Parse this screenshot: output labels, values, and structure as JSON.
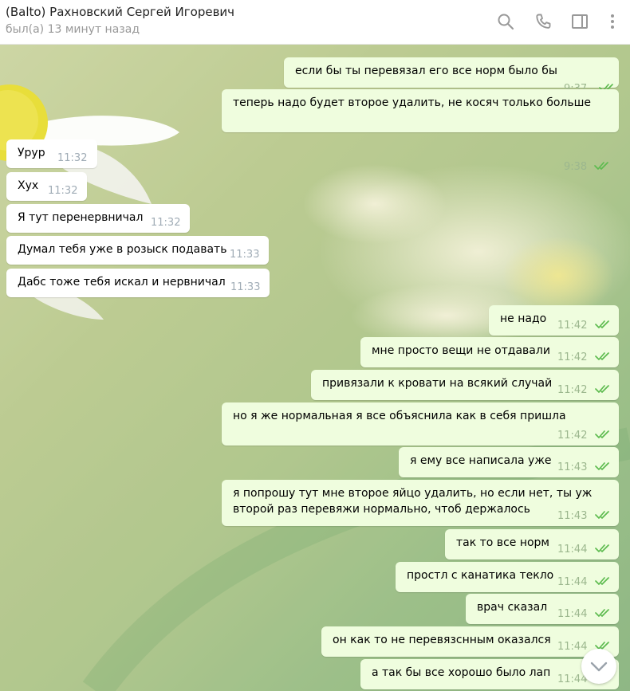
{
  "header": {
    "title": "(Balto) Рахновский Сергей Игоревич",
    "status": "был(а) 13 минут назад",
    "icons": [
      "search-icon",
      "phone-icon",
      "sidebar-toggle-icon",
      "more-vert-icon"
    ]
  },
  "colors": {
    "outgoing_bubble": "#effdde",
    "incoming_bubble": "#ffffff",
    "check": "#5dbb4f"
  },
  "messages": [
    {
      "dir": "out",
      "text": "если бы ты перевязал его все норм было бы",
      "time": "9:37"
    },
    {
      "dir": "out",
      "text": "теперь надо будет второе удалить, не косяч только больше",
      "time": "9:38"
    },
    {
      "dir": "in",
      "text": "Урур",
      "time": "11:32"
    },
    {
      "dir": "in",
      "text": "Хух",
      "time": "11:32"
    },
    {
      "dir": "in",
      "text": "Я тут перенервничал",
      "time": "11:32"
    },
    {
      "dir": "in",
      "text": "Думал тебя уже в розыск подавать",
      "time": "11:33"
    },
    {
      "dir": "in",
      "text": "Дабс тоже тебя искал и нервничал",
      "time": "11:33"
    },
    {
      "dir": "out",
      "text": "не надо",
      "time": "11:42"
    },
    {
      "dir": "out",
      "text": "мне просто вещи не отдавали",
      "time": "11:42"
    },
    {
      "dir": "out",
      "text": "привязали к кровати на всякий случай",
      "time": "11:42"
    },
    {
      "dir": "out",
      "text": "но я же нормальная я все объяснила как в себя пришла",
      "time": "11:42"
    },
    {
      "dir": "out",
      "text": "я ему все написала уже",
      "time": "11:43"
    },
    {
      "dir": "out",
      "text": "я попрошу тут мне второе яйцо удалить, но если нет, ты уж\nвторой раз перевяжи нормально, чтоб держалось",
      "time": "11:43"
    },
    {
      "dir": "out",
      "text": "так то все норм",
      "time": "11:44"
    },
    {
      "dir": "out",
      "text": "простл с канатика текло",
      "time": "11:44"
    },
    {
      "dir": "out",
      "text": "врач сказал",
      "time": "11:44"
    },
    {
      "dir": "out",
      "text": "он как то не перевязснным оказался",
      "time": "11:44"
    },
    {
      "dir": "out",
      "text": "а так бы все хорошо было лап",
      "time": "11:44"
    }
  ]
}
